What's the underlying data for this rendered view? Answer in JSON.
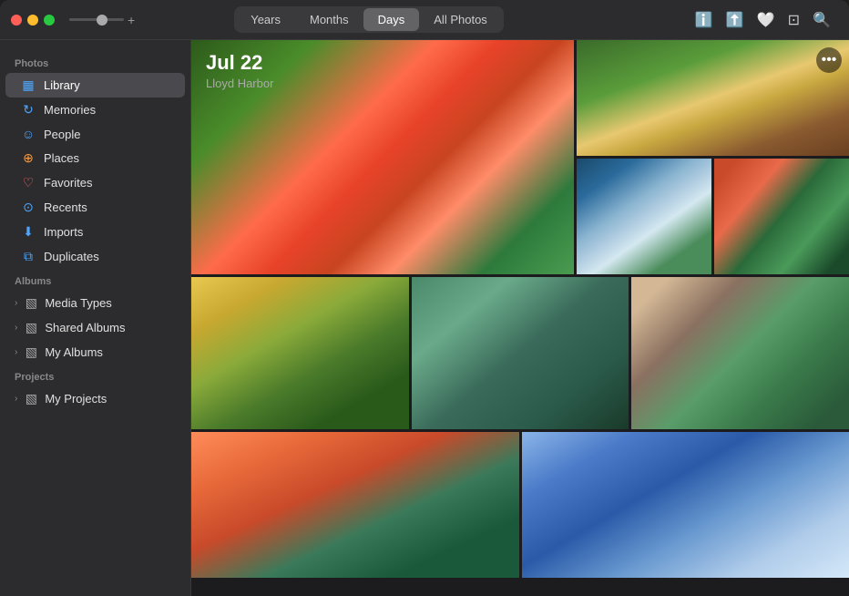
{
  "window": {
    "title": "Photos"
  },
  "titlebar": {
    "zoom_plus": "+",
    "tabs": [
      "Years",
      "Months",
      "Days",
      "All Photos"
    ],
    "active_tab": "Days",
    "icons": [
      "ℹ",
      "⬆",
      "♡",
      "⧉",
      "⌕"
    ]
  },
  "sidebar": {
    "sections": [
      {
        "name": "Photos",
        "items": [
          {
            "id": "library",
            "label": "Library",
            "icon": "▦",
            "icon_type": "blue",
            "active": true
          },
          {
            "id": "memories",
            "label": "Memories",
            "icon": "↻",
            "icon_type": "blue"
          },
          {
            "id": "people",
            "label": "People",
            "icon": "☺",
            "icon_type": "blue"
          },
          {
            "id": "places",
            "label": "Places",
            "icon": "⊕",
            "icon_type": "orange"
          },
          {
            "id": "favorites",
            "label": "Favorites",
            "icon": "♡",
            "icon_type": "red"
          },
          {
            "id": "recents",
            "label": "Recents",
            "icon": "⊙",
            "icon_type": "blue"
          },
          {
            "id": "imports",
            "label": "Imports",
            "icon": "⬇",
            "icon_type": "blue"
          },
          {
            "id": "duplicates",
            "label": "Duplicates",
            "icon": "⧉",
            "icon_type": "blue"
          }
        ]
      },
      {
        "name": "Albums",
        "items": [
          {
            "id": "media-types",
            "label": "Media Types",
            "expandable": true
          },
          {
            "id": "shared-albums",
            "label": "Shared Albums",
            "expandable": true
          },
          {
            "id": "my-albums",
            "label": "My Albums",
            "expandable": true
          }
        ]
      },
      {
        "name": "Projects",
        "items": [
          {
            "id": "my-projects",
            "label": "My Projects",
            "expandable": true
          }
        ]
      }
    ]
  },
  "photo_view": {
    "date_title": "Jul 22",
    "date_subtitle": "Lloyd Harbor",
    "more_button": "•••"
  }
}
